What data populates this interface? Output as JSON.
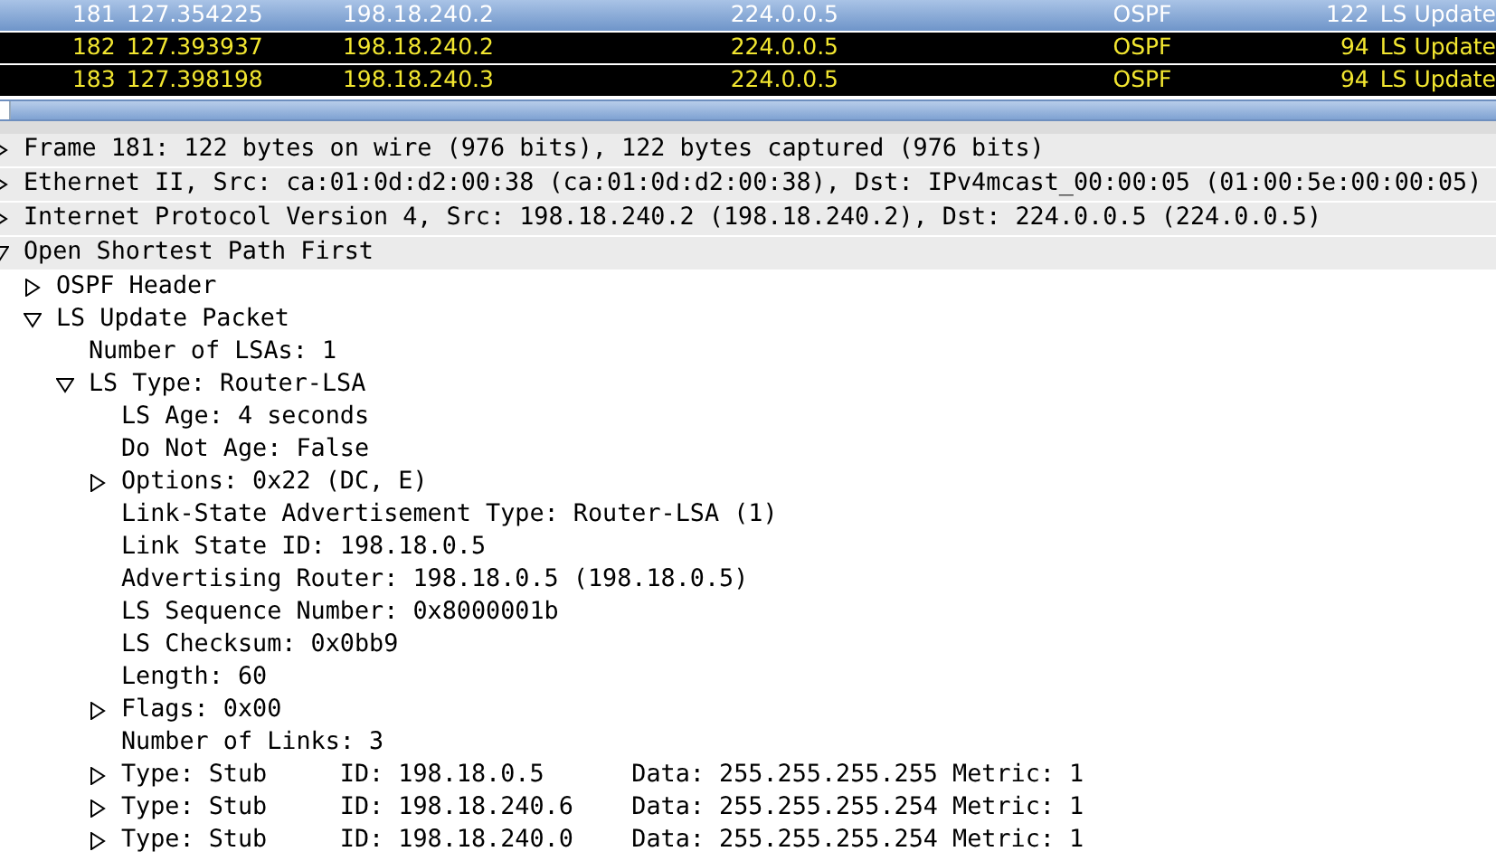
{
  "packet_list": {
    "rows": [
      {
        "no": "181",
        "time": "127.354225",
        "source": "198.18.240.2",
        "destination": "224.0.0.5",
        "protocol": "OSPF",
        "length": "122",
        "info": "LS Update",
        "selected": true
      },
      {
        "no": "182",
        "time": "127.393937",
        "source": "198.18.240.2",
        "destination": "224.0.0.5",
        "protocol": "OSPF",
        "length": "94",
        "info": "LS Update",
        "selected": false
      },
      {
        "no": "183",
        "time": "127.398198",
        "source": "198.18.240.3",
        "destination": "224.0.0.5",
        "protocol": "OSPF",
        "length": "94",
        "info": "LS Update",
        "selected": false
      }
    ]
  },
  "packet_details": [
    {
      "text": "Frame 181: 122 bytes on wire (976 bits), 122 bytes captured (976 bits)",
      "expanded": false
    },
    {
      "text": "Ethernet II, Src: ca:01:0d:d2:00:38 (ca:01:0d:d2:00:38), Dst: IPv4mcast_00:00:05 (01:00:5e:00:00:05)",
      "expanded": false
    },
    {
      "text": "Internet Protocol Version 4, Src: 198.18.240.2 (198.18.240.2), Dst: 224.0.0.5 (224.0.0.5)",
      "expanded": false
    },
    {
      "text": "Open Shortest Path First",
      "expanded": true,
      "children": [
        {
          "text": "OSPF Header",
          "expanded": false
        },
        {
          "text": "LS Update Packet",
          "expanded": true,
          "children": [
            {
              "text": "Number of LSAs: 1"
            },
            {
              "text": "LS Type: Router-LSA",
              "expanded": true,
              "children": [
                {
                  "text": "LS Age: 4 seconds"
                },
                {
                  "text": "Do Not Age: False"
                },
                {
                  "text": "Options: 0x22 (DC, E)",
                  "expanded": false
                },
                {
                  "text": "Link-State Advertisement Type: Router-LSA (1)"
                },
                {
                  "text": "Link State ID: 198.18.0.5"
                },
                {
                  "text": "Advertising Router: 198.18.0.5 (198.18.0.5)"
                },
                {
                  "text": "LS Sequence Number: 0x8000001b"
                },
                {
                  "text": "LS Checksum: 0x0bb9"
                },
                {
                  "text": "Length: 60"
                },
                {
                  "text": "Flags: 0x00",
                  "expanded": false
                },
                {
                  "text": "Number of Links: 3"
                },
                {
                  "text": "Type: Stub     ID: 198.18.0.5      Data: 255.255.255.255 Metric: 1",
                  "expanded": false
                },
                {
                  "text": "Type: Stub     ID: 198.18.240.6    Data: 255.255.255.254 Metric: 1",
                  "expanded": false
                },
                {
                  "text": "Type: Stub     ID: 198.18.240.0    Data: 255.255.255.254 Metric: 1",
                  "expanded": false
                }
              ]
            }
          ]
        }
      ]
    }
  ]
}
